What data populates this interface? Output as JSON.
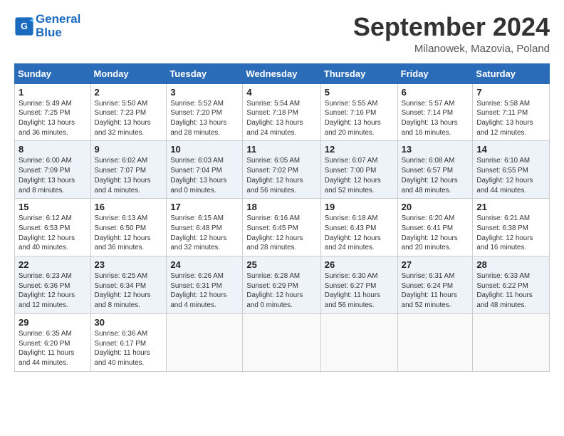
{
  "logo": {
    "line1": "General",
    "line2": "Blue"
  },
  "title": "September 2024",
  "location": "Milanowek, Mazovia, Poland",
  "days_of_week": [
    "Sunday",
    "Monday",
    "Tuesday",
    "Wednesday",
    "Thursday",
    "Friday",
    "Saturday"
  ],
  "weeks": [
    [
      {
        "day": "1",
        "info": "Sunrise: 5:49 AM\nSunset: 7:25 PM\nDaylight: 13 hours\nand 36 minutes."
      },
      {
        "day": "2",
        "info": "Sunrise: 5:50 AM\nSunset: 7:23 PM\nDaylight: 13 hours\nand 32 minutes."
      },
      {
        "day": "3",
        "info": "Sunrise: 5:52 AM\nSunset: 7:20 PM\nDaylight: 13 hours\nand 28 minutes."
      },
      {
        "day": "4",
        "info": "Sunrise: 5:54 AM\nSunset: 7:18 PM\nDaylight: 13 hours\nand 24 minutes."
      },
      {
        "day": "5",
        "info": "Sunrise: 5:55 AM\nSunset: 7:16 PM\nDaylight: 13 hours\nand 20 minutes."
      },
      {
        "day": "6",
        "info": "Sunrise: 5:57 AM\nSunset: 7:14 PM\nDaylight: 13 hours\nand 16 minutes."
      },
      {
        "day": "7",
        "info": "Sunrise: 5:58 AM\nSunset: 7:11 PM\nDaylight: 13 hours\nand 12 minutes."
      }
    ],
    [
      {
        "day": "8",
        "info": "Sunrise: 6:00 AM\nSunset: 7:09 PM\nDaylight: 13 hours\nand 8 minutes."
      },
      {
        "day": "9",
        "info": "Sunrise: 6:02 AM\nSunset: 7:07 PM\nDaylight: 13 hours\nand 4 minutes."
      },
      {
        "day": "10",
        "info": "Sunrise: 6:03 AM\nSunset: 7:04 PM\nDaylight: 13 hours\nand 0 minutes."
      },
      {
        "day": "11",
        "info": "Sunrise: 6:05 AM\nSunset: 7:02 PM\nDaylight: 12 hours\nand 56 minutes."
      },
      {
        "day": "12",
        "info": "Sunrise: 6:07 AM\nSunset: 7:00 PM\nDaylight: 12 hours\nand 52 minutes."
      },
      {
        "day": "13",
        "info": "Sunrise: 6:08 AM\nSunset: 6:57 PM\nDaylight: 12 hours\nand 48 minutes."
      },
      {
        "day": "14",
        "info": "Sunrise: 6:10 AM\nSunset: 6:55 PM\nDaylight: 12 hours\nand 44 minutes."
      }
    ],
    [
      {
        "day": "15",
        "info": "Sunrise: 6:12 AM\nSunset: 6:53 PM\nDaylight: 12 hours\nand 40 minutes."
      },
      {
        "day": "16",
        "info": "Sunrise: 6:13 AM\nSunset: 6:50 PM\nDaylight: 12 hours\nand 36 minutes."
      },
      {
        "day": "17",
        "info": "Sunrise: 6:15 AM\nSunset: 6:48 PM\nDaylight: 12 hours\nand 32 minutes."
      },
      {
        "day": "18",
        "info": "Sunrise: 6:16 AM\nSunset: 6:45 PM\nDaylight: 12 hours\nand 28 minutes."
      },
      {
        "day": "19",
        "info": "Sunrise: 6:18 AM\nSunset: 6:43 PM\nDaylight: 12 hours\nand 24 minutes."
      },
      {
        "day": "20",
        "info": "Sunrise: 6:20 AM\nSunset: 6:41 PM\nDaylight: 12 hours\nand 20 minutes."
      },
      {
        "day": "21",
        "info": "Sunrise: 6:21 AM\nSunset: 6:38 PM\nDaylight: 12 hours\nand 16 minutes."
      }
    ],
    [
      {
        "day": "22",
        "info": "Sunrise: 6:23 AM\nSunset: 6:36 PM\nDaylight: 12 hours\nand 12 minutes."
      },
      {
        "day": "23",
        "info": "Sunrise: 6:25 AM\nSunset: 6:34 PM\nDaylight: 12 hours\nand 8 minutes."
      },
      {
        "day": "24",
        "info": "Sunrise: 6:26 AM\nSunset: 6:31 PM\nDaylight: 12 hours\nand 4 minutes."
      },
      {
        "day": "25",
        "info": "Sunrise: 6:28 AM\nSunset: 6:29 PM\nDaylight: 12 hours\nand 0 minutes."
      },
      {
        "day": "26",
        "info": "Sunrise: 6:30 AM\nSunset: 6:27 PM\nDaylight: 11 hours\nand 56 minutes."
      },
      {
        "day": "27",
        "info": "Sunrise: 6:31 AM\nSunset: 6:24 PM\nDaylight: 11 hours\nand 52 minutes."
      },
      {
        "day": "28",
        "info": "Sunrise: 6:33 AM\nSunset: 6:22 PM\nDaylight: 11 hours\nand 48 minutes."
      }
    ],
    [
      {
        "day": "29",
        "info": "Sunrise: 6:35 AM\nSunset: 6:20 PM\nDaylight: 11 hours\nand 44 minutes."
      },
      {
        "day": "30",
        "info": "Sunrise: 6:36 AM\nSunset: 6:17 PM\nDaylight: 11 hours\nand 40 minutes."
      },
      {
        "day": "",
        "info": ""
      },
      {
        "day": "",
        "info": ""
      },
      {
        "day": "",
        "info": ""
      },
      {
        "day": "",
        "info": ""
      },
      {
        "day": "",
        "info": ""
      }
    ]
  ]
}
